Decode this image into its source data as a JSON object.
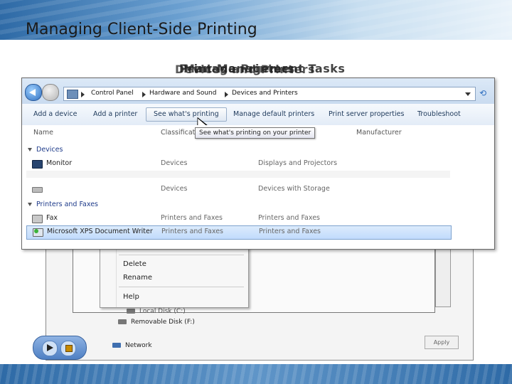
{
  "slide": {
    "title": "Managing Client-Side Printing",
    "overlapping_heading_a": "Print Management Tasks",
    "overlapping_heading_b": "Devices and Printers",
    "overlapping_heading_c": "Manage Printers"
  },
  "colors": {
    "accent": "#2e6aa6",
    "selection": "#c1dbfc",
    "link": "#1e395b"
  },
  "explorer": {
    "breadcrumb": [
      "Control Panel",
      "Hardware and Sound",
      "Devices and Printers"
    ],
    "commands": [
      "Add a device",
      "Add a printer",
      "See what's printing",
      "Manage default printers",
      "Print server properties",
      "Troubleshoot"
    ],
    "tooltip": "See what's printing on your printer",
    "columns": [
      "Name",
      "Classificat",
      "Manufacturer"
    ],
    "groups": [
      "Devices",
      "Printers and Faxes"
    ],
    "devices": [
      {
        "name": "Monitor",
        "category": "Devices",
        "description": "Displays and Projectors",
        "icon": "monitor-icon"
      },
      {
        "name": "",
        "category": "Devices",
        "description": "Devices with Storage",
        "icon": "disk-icon"
      }
    ],
    "printers": [
      {
        "name": "Fax",
        "category": "Printers and Faxes",
        "description": "Printers and Faxes",
        "icon": "fax-icon"
      },
      {
        "name": "Microsoft XPS Document Writer",
        "category": "Printers and Faxes",
        "description": "Printers and Faxes",
        "icon": "printer-icon"
      }
    ]
  },
  "context_menu": [
    "Delete",
    "Rename",
    "Help"
  ],
  "background_tree": [
    "Removable Disk (F:)",
    "Network"
  ],
  "background_partial": "Local Disk (C:)",
  "apply_label": "Apply"
}
